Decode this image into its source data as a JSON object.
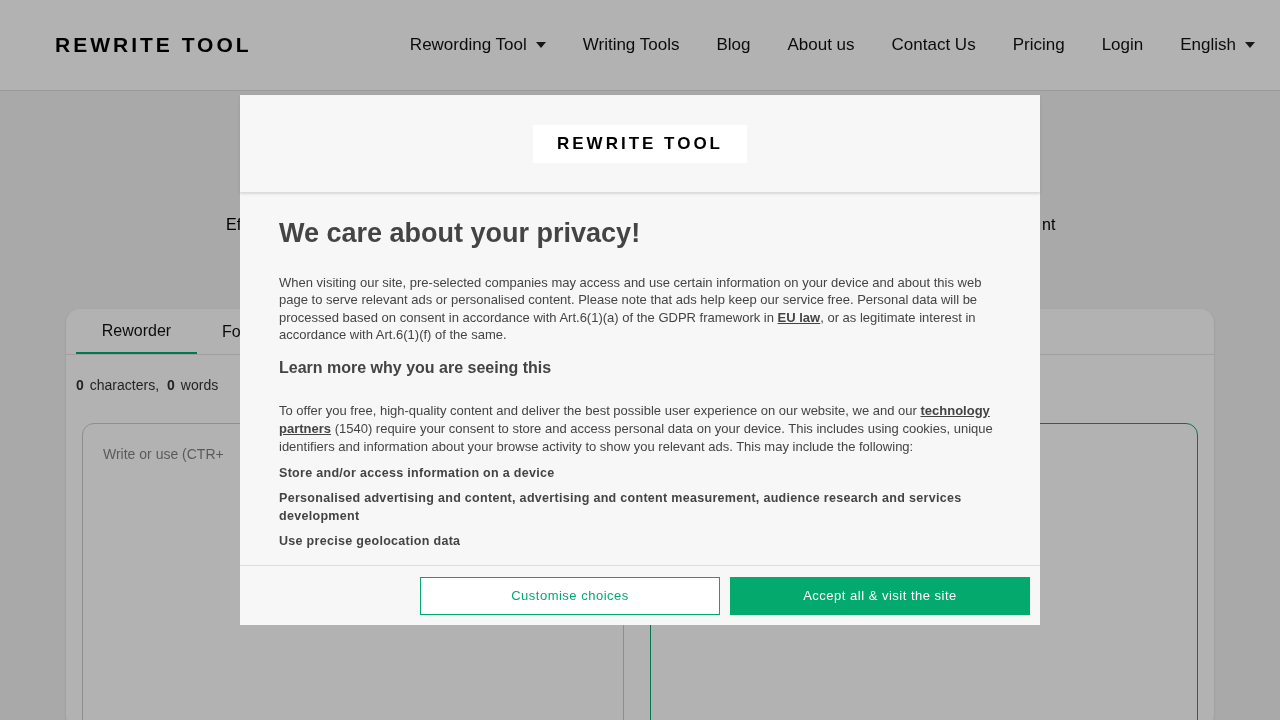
{
  "header": {
    "logo": "REWRITE TOOL",
    "nav": [
      {
        "label": "Rewording Tool",
        "dropdown": true
      },
      {
        "label": "Writing Tools",
        "dropdown": false
      },
      {
        "label": "Blog",
        "dropdown": false
      },
      {
        "label": "About us",
        "dropdown": false
      },
      {
        "label": "Contact Us",
        "dropdown": false
      },
      {
        "label": "Pricing",
        "dropdown": false
      },
      {
        "label": "Login",
        "dropdown": false
      },
      {
        "label": "English",
        "dropdown": true
      }
    ]
  },
  "hero": {
    "subtitle_start": "Ef",
    "subtitle_end": "nt"
  },
  "editor": {
    "tabs": [
      {
        "label": "Reworder",
        "selected": true
      },
      {
        "label": "Fo",
        "selected": false
      }
    ],
    "char_count": "0",
    "char_label": "characters,",
    "word_count": "0",
    "word_label": "words",
    "input": {
      "placeholder": "Write or use (CTR+"
    }
  },
  "consent_dialog": {
    "logo": "REWRITE TOOL",
    "title": "We care about your privacy!",
    "intro": "When visiting our site, pre-selected companies may access and use certain information on your device and about this web page to serve relevant ads or personalised content. Please note that ads help keep our service free. Personal data will be processed based on consent in accordance with Art.6(1)(a) of the GDPR framework in **EU law**, or as legitimate interest in accordance with Art.6(1)(f) of the same.",
    "subtitle": "Learn more why you are seeing this",
    "details": "To offer you free, high-quality content and deliver the best possible user experience on our website, we and our **technology partners** (1540) require your consent to store and access personal data on your device. This includes using cookies, unique identifiers and information about your browse activity to show you relevant ads. This may include the following:",
    "purposes": [
      "Store and/or access information on a device",
      "Personalised advertising and content, advertising and content measurement, audience research and services development",
      "Use precise geolocation data"
    ],
    "buttons": [
      {
        "label": "Customise choices",
        "kind": "secondary"
      },
      {
        "label": "Accept all & visit the site",
        "kind": "primary"
      }
    ]
  }
}
